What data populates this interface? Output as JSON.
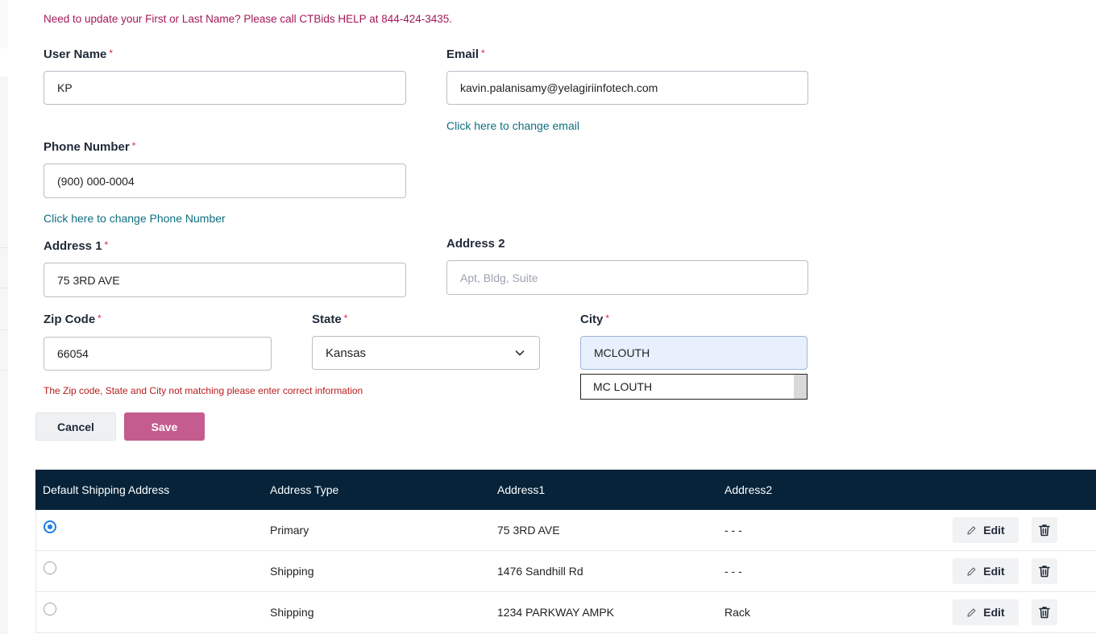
{
  "notice": "Need to update your First or Last Name? Please call CTBids HELP at 844-424-3435.",
  "required_mark": "*",
  "form": {
    "username": {
      "label": "User Name",
      "value": "KP"
    },
    "email": {
      "label": "Email",
      "value": "kavin.palanisamy@yelagiriinfotech.com",
      "change_link": "Click here to change email"
    },
    "phone": {
      "label": "Phone Number",
      "value": "(900) 000-0004",
      "change_link": "Click here to change Phone Number"
    },
    "address1": {
      "label": "Address 1",
      "value": "75 3RD AVE"
    },
    "address2": {
      "label": "Address 2",
      "value": "",
      "placeholder": "Apt, Bldg, Suite"
    },
    "zip": {
      "label": "Zip Code",
      "value": "66054"
    },
    "state": {
      "label": "State",
      "value": "Kansas"
    },
    "city": {
      "label": "City",
      "value": "MCLOUTH",
      "suggestion": "MC LOUTH"
    },
    "error": "The Zip code, State and City not matching please enter correct information"
  },
  "buttons": {
    "cancel": "Cancel",
    "save": "Save"
  },
  "table": {
    "headers": [
      "Default Shipping Address",
      "Address Type",
      "Address1",
      "Address2"
    ],
    "edit_label": "Edit",
    "rows": [
      {
        "selected": true,
        "type": "Primary",
        "address1": "75 3RD AVE",
        "address2": "- - -"
      },
      {
        "selected": false,
        "type": "Shipping",
        "address1": "1476 Sandhill Rd",
        "address2": "- - -"
      },
      {
        "selected": false,
        "type": "Shipping",
        "address1": "1234 PARKWAY AMPK",
        "address2": "Rack"
      }
    ]
  },
  "icons": {
    "select_arrow": "chevron-down-icon",
    "edit": "pencil-icon",
    "delete": "trash-icon"
  },
  "colors": {
    "notice": "#a3195b",
    "link": "#0e6f7f",
    "error": "#b91c1c",
    "save_button": "#c45c8f",
    "table_header": "#062339",
    "radio_selected": "#1d7ee8"
  }
}
